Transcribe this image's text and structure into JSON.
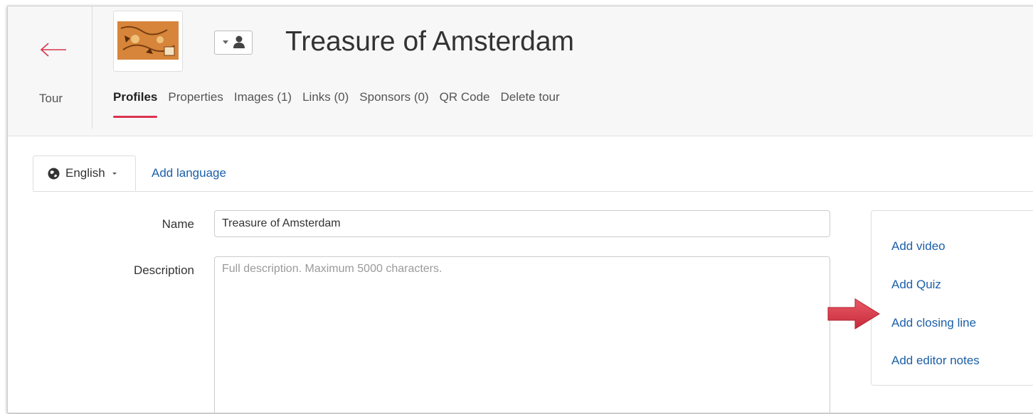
{
  "header": {
    "back_label": "Tour",
    "title": "Treasure of Amsterdam",
    "tabs": [
      {
        "label": "Profiles",
        "active": true
      },
      {
        "label": "Properties",
        "active": false
      },
      {
        "label": "Images (1)",
        "active": false
      },
      {
        "label": "Links (0)",
        "active": false
      },
      {
        "label": "Sponsors (0)",
        "active": false
      },
      {
        "label": "QR Code",
        "active": false
      },
      {
        "label": "Delete tour",
        "active": false
      }
    ]
  },
  "language": {
    "selected": "English",
    "add_label": "Add language"
  },
  "form": {
    "name_label": "Name",
    "name_value": "Treasure of Amsterdam",
    "description_label": "Description",
    "description_placeholder": "Full description. Maximum 5000 characters."
  },
  "side_panel": {
    "links": [
      "Add video",
      "Add Quiz",
      "Add closing line",
      "Add editor notes"
    ]
  },
  "colors": {
    "accent": "#d9344e",
    "link": "#1c5fa8",
    "highlight_arrow": "#d63a4b"
  },
  "icons": {
    "back": "arrow-left-icon",
    "avatar": "user-icon",
    "language": "globe-icon",
    "dropdown": "caret-down-icon",
    "pointer": "red-arrow-icon"
  }
}
